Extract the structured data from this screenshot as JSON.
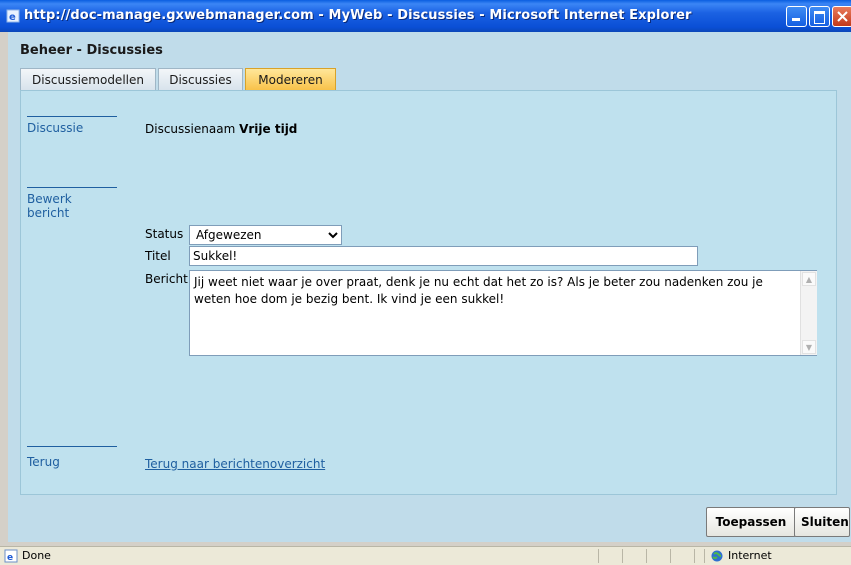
{
  "window": {
    "title": "http://doc-manage.gxwebmanager.com - MyWeb - Discussies - Microsoft Internet Explorer",
    "controls": [
      "minimize",
      "maximize",
      "close"
    ]
  },
  "page": {
    "heading": "Beheer - Discussies",
    "tabs": [
      {
        "label": "Discussiemodellen",
        "active": false
      },
      {
        "label": "Discussies",
        "active": false
      },
      {
        "label": "Modereren",
        "active": true
      }
    ]
  },
  "sections": {
    "discussie": {
      "label": "Discussie",
      "name_label": "Discussienaam",
      "name_value": "Vrije tijd"
    },
    "bewerk": {
      "label_line1": "Bewerk",
      "label_line2": "bericht",
      "status_label": "Status",
      "status_value": "Afgewezen",
      "titel_label": "Titel",
      "titel_value": "Sukkel!",
      "bericht_label": "Bericht",
      "bericht_value": "Jij weet niet waar je over praat, denk je nu echt dat het zo is? Als je beter zou nadenken zou je weten hoe dom je bezig bent. Ik vind je een sukkel!"
    },
    "terug": {
      "label": "Terug",
      "link": "Terug naar berichtenoverzicht"
    }
  },
  "buttons": {
    "apply": "Toepassen",
    "close": "Sluiten"
  },
  "statusbar": {
    "text": "Done",
    "zone": "Internet"
  },
  "colors": {
    "titlebar": "#0a4fd6",
    "page_bg": "#c0dcea",
    "link": "#1f5fa0",
    "active_tab": "#f8c24a"
  }
}
